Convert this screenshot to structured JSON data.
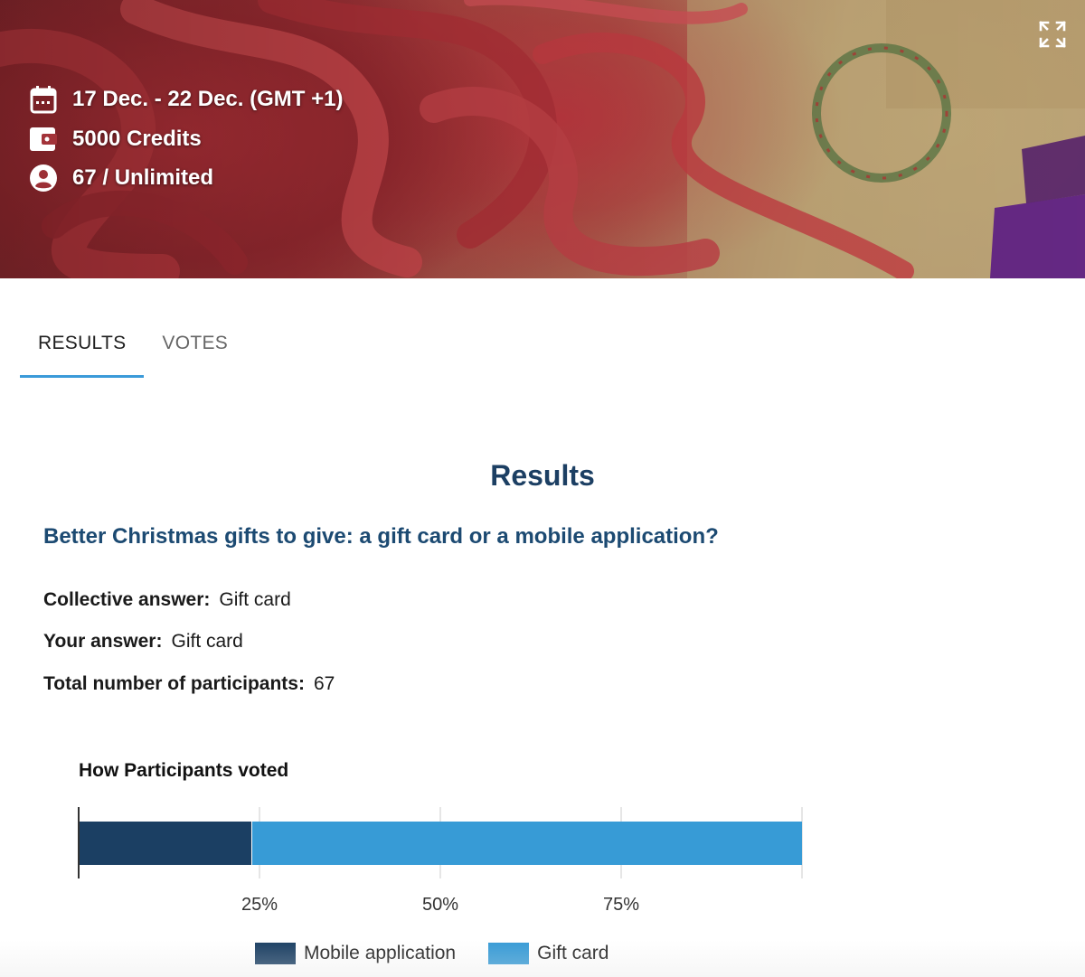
{
  "hero": {
    "date_range": "17 Dec. - 22 Dec. (GMT +1)",
    "credits": "5000 Credits",
    "participants": "67 / Unlimited",
    "icons": [
      "calendar-icon",
      "wallet-icon",
      "account-circle-icon",
      "fullscreen-icon"
    ]
  },
  "tabs": [
    {
      "label": "RESULTS",
      "active": true
    },
    {
      "label": "VOTES",
      "active": false
    }
  ],
  "results": {
    "title": "Results",
    "question": "Better Christmas gifts to give: a gift card or a mobile application?",
    "collective_label": "Collective answer:",
    "collective_value": "Gift card",
    "your_label": "Your answer:",
    "your_value": "Gift card",
    "total_label": "Total number of participants:",
    "total_value": "67"
  },
  "chart_data": {
    "type": "bar",
    "orientation": "horizontal-stacked",
    "title": "How Participants voted",
    "categories": [
      ""
    ],
    "series": [
      {
        "name": "Mobile application",
        "values": [
          24
        ],
        "color": "#1b3f63"
      },
      {
        "name": "Gift card",
        "values": [
          76
        ],
        "color": "#379bd6"
      }
    ],
    "xlim": [
      0,
      100
    ],
    "tick_labels": [
      "25%",
      "50%",
      "75%"
    ],
    "tick_values": [
      25,
      50,
      75
    ],
    "grid": true,
    "legend": "bottom"
  }
}
